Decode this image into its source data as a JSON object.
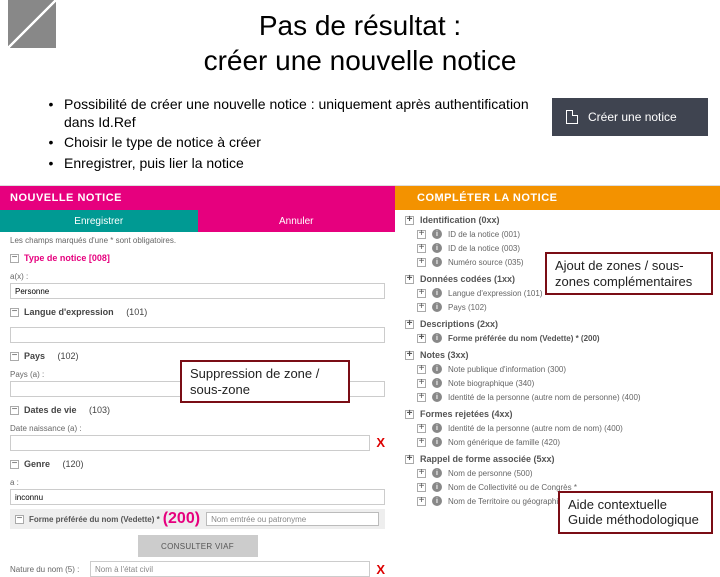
{
  "slide": {
    "title": "Pas de résultat :\ncréer une nouvelle notice",
    "bullets": [
      "Possibilité de créer une nouvelle notice : uniquement après authentification dans Id.Ref",
      "Choisir le type de notice à créer",
      "Enregistrer, puis lier la notice"
    ],
    "create_btn": "Créer une notice"
  },
  "left": {
    "header": "NOUVELLE NOTICE",
    "save": "Enregistrer",
    "cancel": "Annuler",
    "hint": "Les champs marqués d'une * sont obligatoires.",
    "sections": {
      "type": {
        "label": "Type de notice",
        "code": "[008]"
      },
      "type_sub": "a(x) :",
      "type_val": "Personne",
      "lang": {
        "label": "Langue d'expression",
        "code": "(101)"
      },
      "pays": {
        "label": "Pays",
        "code": "(102)"
      },
      "pays_sub": "Pays (a) :",
      "dates": {
        "label": "Dates de vie",
        "code": "(103)"
      },
      "dates_sub": "Date naissance (a) :",
      "genre": {
        "label": "Genre",
        "code": "(120)"
      },
      "genre_sub": "a :",
      "genre_val": "inconnu",
      "vedette": {
        "label": "Forme préférée du nom (Vedette) *",
        "code": "(200)",
        "placeholder": "Nom emtrée ou patronyme"
      },
      "consult": "CONSULTER VIAF",
      "nom": {
        "label": "Nature du nom (5) :",
        "placeholder": "Nom à l'état civil"
      }
    }
  },
  "right": {
    "header": "COMPLÉTER LA NOTICE",
    "groups": [
      {
        "title": "Identification",
        "code": "(0xx)",
        "items": [
          {
            "label": "ID de la notice",
            "code": "(001)"
          },
          {
            "label": "ID de la notice",
            "code": "(003)"
          },
          {
            "label": "Numéro source",
            "code": "(035)"
          }
        ]
      },
      {
        "title": "Données codées",
        "code": "(1xx)",
        "items": [
          {
            "label": "Langue d'expression",
            "code": "(101)"
          },
          {
            "label": "Pays",
            "code": "(102)"
          }
        ]
      },
      {
        "title": "Descriptions",
        "code": "(2xx)",
        "items": [
          {
            "label": "Forme préférée du nom (Vedette) *",
            "code": "(200)",
            "bold": true
          }
        ]
      },
      {
        "title": "Notes",
        "code": "(3xx)",
        "items": [
          {
            "label": "Note publique d'information",
            "code": "(300)"
          },
          {
            "label": "Note biographique",
            "code": "(340)"
          },
          {
            "label": "Identité de la personne (autre nom de personne)",
            "code": "(400)"
          }
        ]
      },
      {
        "title": "Formes rejetées",
        "code": "(4xx)",
        "items": [
          {
            "label": "Identité de la personne (autre nom de nom)",
            "code": "(400)"
          },
          {
            "label": "Nom générique de famille",
            "code": "(420)"
          }
        ]
      },
      {
        "title": "Rappel de forme associée",
        "code": "(5xx)",
        "items": [
          {
            "label": "Nom de personne",
            "code": "(500)"
          },
          {
            "label": "Nom de Collectivité ou de Congrès *",
            "code": ""
          },
          {
            "label": "Nom de Territoire ou géographique",
            "code": ""
          }
        ]
      }
    ]
  },
  "callouts": {
    "c1": "Ajout de zones / sous-zones complémentaires",
    "c2": "Suppression de zone / sous-zone",
    "c3": "Aide contextuelle Guide méthodologique"
  }
}
